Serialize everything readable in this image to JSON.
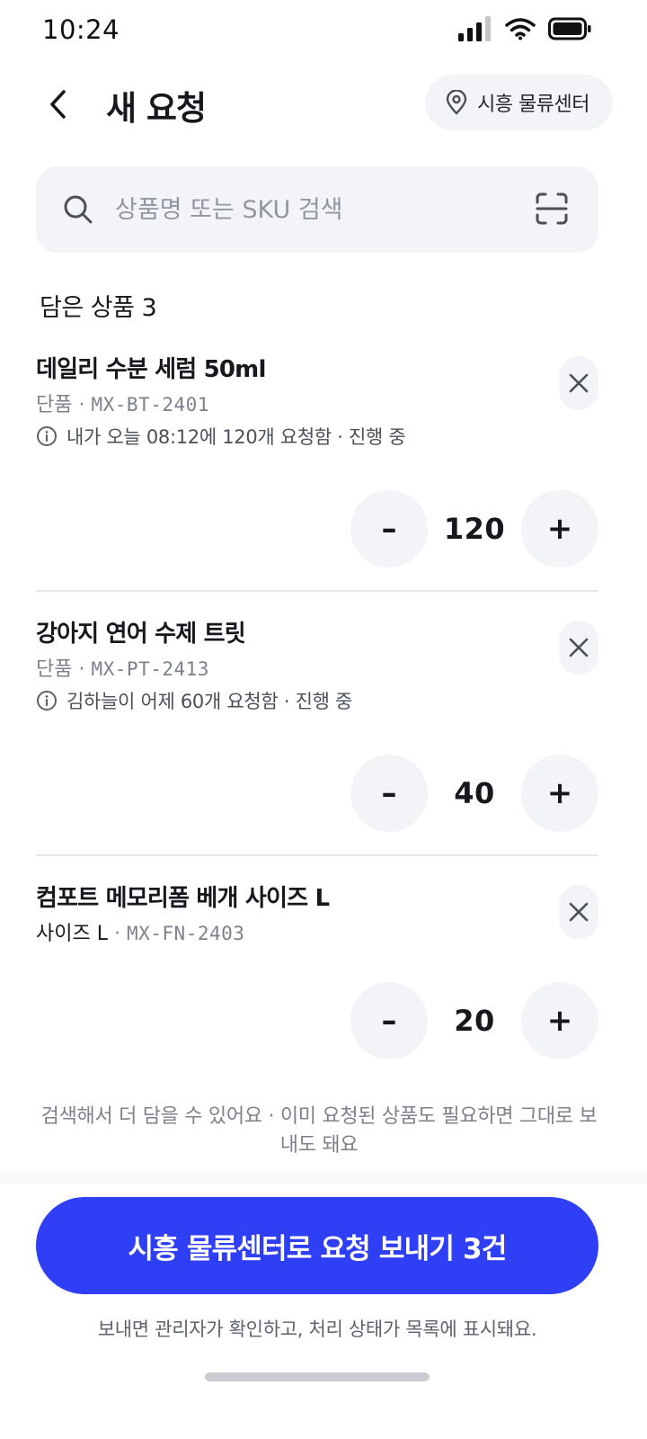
{
  "status_bar": {
    "time": "10:24"
  },
  "header": {
    "title": "새 요청",
    "location": "시흥 물류센터"
  },
  "search": {
    "placeholder": "상품명 또는 SKU 검색"
  },
  "cart": {
    "count_label": "담은 상품 3"
  },
  "items": [
    {
      "name": "데일리 수분 세럼 50ml",
      "variant": "단품",
      "sku": "MX-BT-2401",
      "note": "내가 오늘 08:12에 120개 요청함 · 진행 중",
      "quantity": "120"
    },
    {
      "name": "강아지 연어 수제 트릿",
      "variant": "단품",
      "sku": "MX-PT-2413",
      "note": "김하늘이 어제 60개 요청함 · 진행 중",
      "quantity": "40"
    },
    {
      "name": "컴포트 메모리폼 베개 사이즈 L",
      "variant": "사이즈 L",
      "sku": "MX-FN-2403",
      "quantity": "20"
    }
  ],
  "stepper": {
    "minus": "–",
    "plus": "+"
  },
  "helper_text": "검색해서 더 담을 수 있어요 · 이미 요청된 상품도 필요하면 그대로 보내도 돼요",
  "submit": {
    "label": "시흥 물류센터로 요청 보내기 3건",
    "note": "보내면 관리자가 확인하고, 처리 상태가 목록에 표시돼요."
  },
  "colors": {
    "primary": "#2f3ff5",
    "surface": "#f3f4f7",
    "text": "#16181d",
    "muted": "#7c818b"
  }
}
